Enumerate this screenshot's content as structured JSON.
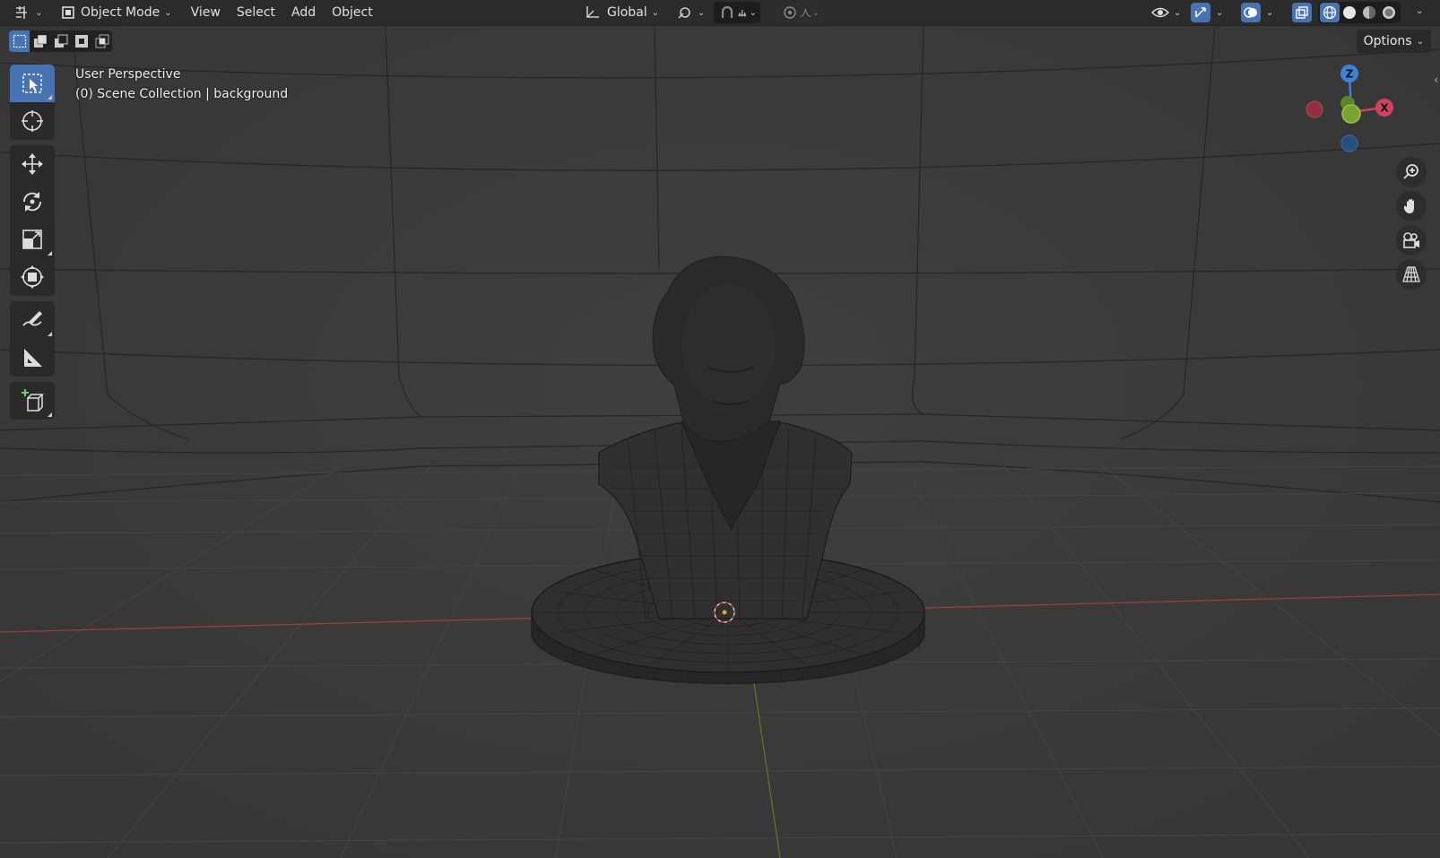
{
  "header": {
    "mode_label": "Object Mode",
    "menus": [
      "View",
      "Select",
      "Add",
      "Object"
    ],
    "orientation_label": "Global",
    "options_label": "Options"
  },
  "overlay": {
    "view_name": "User Perspective",
    "collection_line": "(0) Scene Collection | background"
  },
  "gizmo": {
    "axis_z": "Z",
    "axis_x": "X"
  },
  "colors": {
    "accent": "#4772b3",
    "header_bg": "#2b2b2b",
    "viewport_bg": "#393939",
    "axis_x": "#d1435a",
    "axis_y": "#7aa32f",
    "axis_z": "#3d82d9",
    "x_axis_line": "#a8403f",
    "y_axis_line": "#6b8a2b"
  },
  "toolbar": {
    "tools": [
      "select-box",
      "cursor",
      "move",
      "rotate",
      "scale",
      "transform",
      "annotate",
      "measure",
      "add-cube"
    ],
    "active_tool": "select-box"
  },
  "shading": {
    "active_mode": "wireframe",
    "modes": [
      "wireframe",
      "solid",
      "material-preview",
      "rendered"
    ]
  }
}
